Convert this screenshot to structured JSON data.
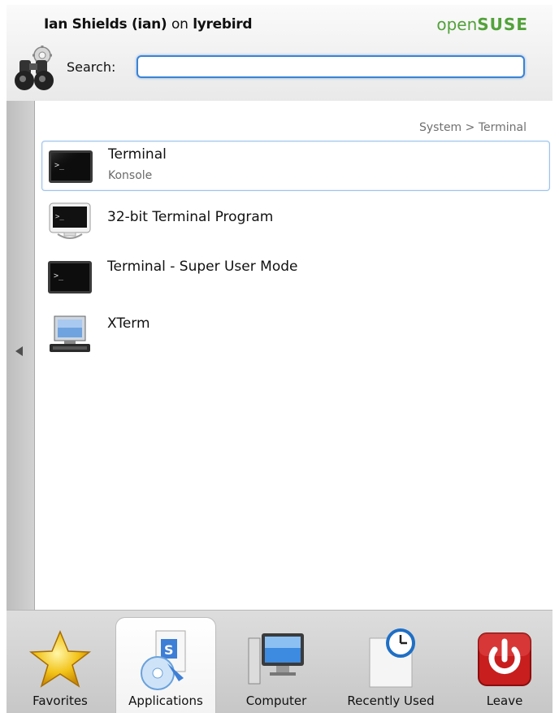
{
  "header": {
    "user": "Ian Shields (ian)",
    "on_word": "on",
    "host": "lyrebird",
    "brand_prefix": "open",
    "brand_suffix": "SUSE"
  },
  "search": {
    "label": "Search:",
    "value": "",
    "placeholder": ""
  },
  "breadcrumb": "System > Terminal",
  "apps": [
    {
      "name": "Terminal",
      "desc": "Konsole",
      "icon": "terminal-icon",
      "selected": true
    },
    {
      "name": "32-bit Terminal Program",
      "desc": "",
      "icon": "monitor-terminal-icon",
      "selected": false
    },
    {
      "name": "Terminal - Super User Mode",
      "desc": "",
      "icon": "terminal-icon",
      "selected": false
    },
    {
      "name": "XTerm",
      "desc": "",
      "icon": "xterm-computer-icon",
      "selected": false
    }
  ],
  "tabs": [
    {
      "label": "Favorites",
      "icon": "star-icon",
      "active": false
    },
    {
      "label": "Applications",
      "icon": "applications-icon",
      "active": true
    },
    {
      "label": "Computer",
      "icon": "computer-icon",
      "active": false
    },
    {
      "label": "Recently Used",
      "icon": "recent-document-icon",
      "active": false
    },
    {
      "label": "Leave",
      "icon": "power-icon",
      "active": false
    }
  ],
  "colors": {
    "brand_green": "#52a23a",
    "focus_blue": "#3a83d6",
    "selection_border": "#9cc2ea"
  }
}
